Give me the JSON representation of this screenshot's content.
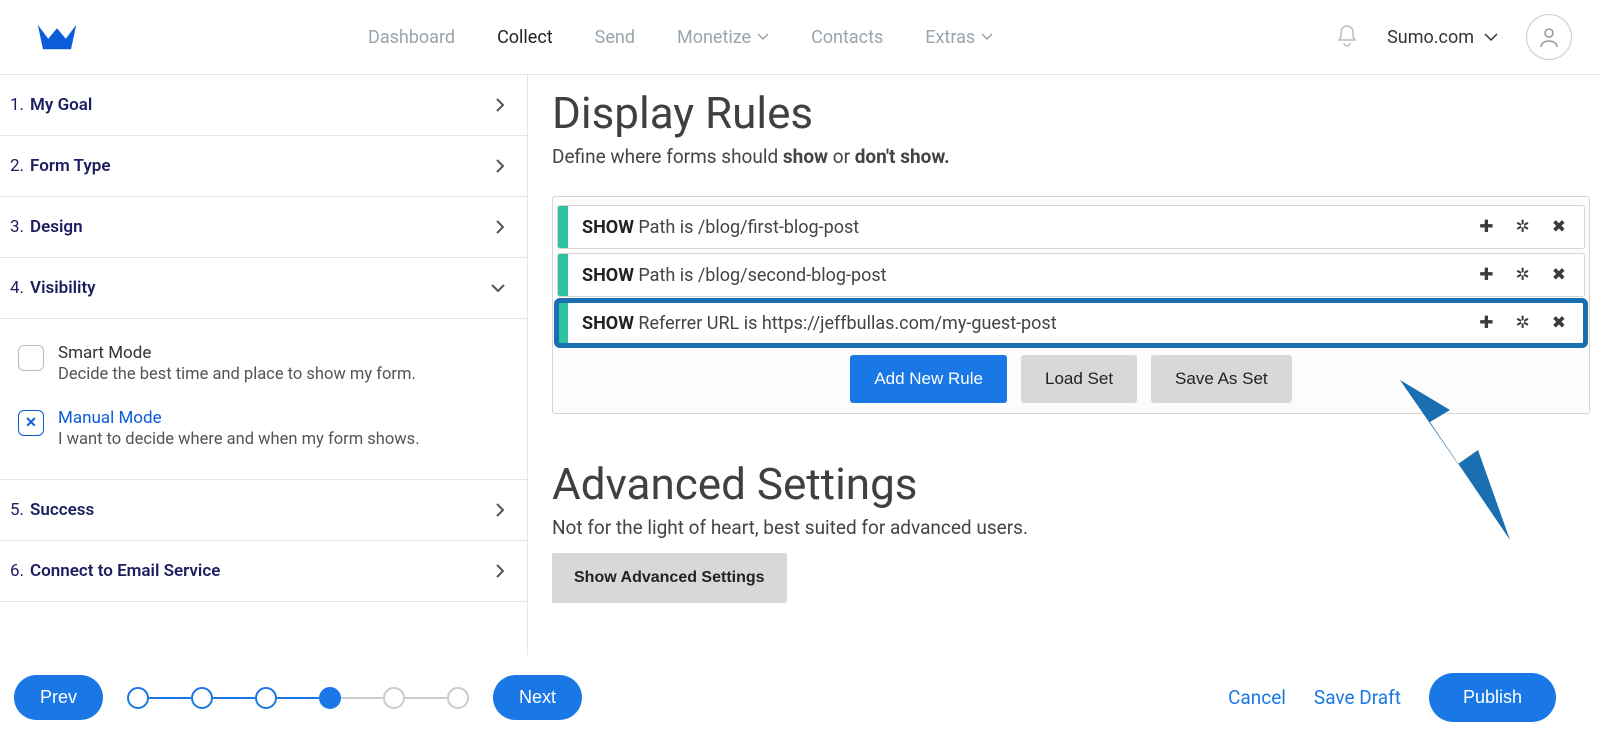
{
  "header": {
    "nav": [
      "Dashboard",
      "Collect",
      "Send",
      "Monetize",
      "Contacts",
      "Extras"
    ],
    "active_nav": "Collect",
    "account_label": "Sumo.com"
  },
  "sidebar": {
    "steps": [
      {
        "num": "1.",
        "label": "My Goal",
        "expanded": false
      },
      {
        "num": "2.",
        "label": "Form Type",
        "expanded": false
      },
      {
        "num": "3.",
        "label": "Design",
        "expanded": false
      },
      {
        "num": "4.",
        "label": "Visibility",
        "expanded": true
      },
      {
        "num": "5.",
        "label": "Success",
        "expanded": false
      },
      {
        "num": "6.",
        "label": "Connect to Email Service",
        "expanded": false
      }
    ],
    "visibility": {
      "smart": {
        "title": "Smart Mode",
        "desc": "Decide the best time and place to show my form."
      },
      "manual": {
        "title": "Manual Mode",
        "desc": "I want to decide where and when my form shows."
      }
    }
  },
  "main": {
    "display_rules": {
      "title": "Display Rules",
      "desc_pre": "Define where forms should ",
      "desc_show": "show",
      "desc_mid": " or ",
      "desc_dont": "don't show.",
      "rules": [
        {
          "prefix": "SHOW",
          "text": " Path is /blog/first-blog-post",
          "highlight": false
        },
        {
          "prefix": "SHOW",
          "text": " Path is /blog/second-blog-post",
          "highlight": false
        },
        {
          "prefix": "SHOW",
          "text": " Referrer URL is https://jeffbullas.com/my-guest-post",
          "highlight": true
        }
      ],
      "add_btn": "Add New Rule",
      "load_btn": "Load Set",
      "save_btn": "Save As Set"
    },
    "advanced": {
      "title": "Advanced Settings",
      "desc": "Not for the light of heart, best suited for advanced users.",
      "show_btn": "Show Advanced Settings"
    }
  },
  "footer": {
    "prev": "Prev",
    "next": "Next",
    "cancel": "Cancel",
    "save_draft": "Save Draft",
    "publish": "Publish"
  }
}
